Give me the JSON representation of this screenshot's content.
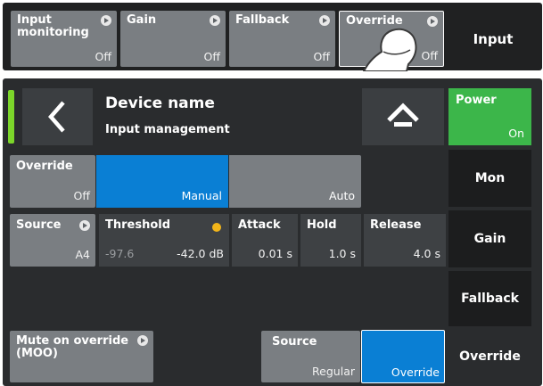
{
  "top_bar": {
    "buttons": [
      {
        "label": "Input monitoring",
        "value": "Off"
      },
      {
        "label": "Gain",
        "value": "Off"
      },
      {
        "label": "Fallback",
        "value": "Off"
      },
      {
        "label": "Override",
        "value": "Off"
      }
    ],
    "side_label": "Input"
  },
  "header": {
    "device_name": "Device name",
    "subtitle": "Input management",
    "power_label": "Power",
    "power_value": "On"
  },
  "override_row": {
    "label": "Override",
    "value": "Off",
    "options": [
      "Manual",
      "Auto"
    ],
    "selected": "Manual"
  },
  "params": {
    "source": {
      "label": "Source",
      "value": "A4"
    },
    "threshold": {
      "label": "Threshold",
      "level": "-97.6",
      "value": "-42.0 dB"
    },
    "attack": {
      "label": "Attack",
      "value": "0.01 s"
    },
    "hold": {
      "label": "Hold",
      "value": "1.0 s"
    },
    "release": {
      "label": "Release",
      "value": "4.0 s"
    }
  },
  "bottom_row": {
    "moo_label": "Mute on override (MOO)",
    "source_label": "Source",
    "source_options": [
      "Regular",
      "Override"
    ],
    "source_selected": "Override"
  },
  "sidebar": {
    "items": [
      "Mon",
      "Gain",
      "Fallback",
      "Override"
    ]
  },
  "colors": {
    "accent_blue": "#0a7fd4",
    "power_green": "#3cb64a",
    "indicator_green": "#7cd62a",
    "threshold_dot": "#f2b51a"
  }
}
